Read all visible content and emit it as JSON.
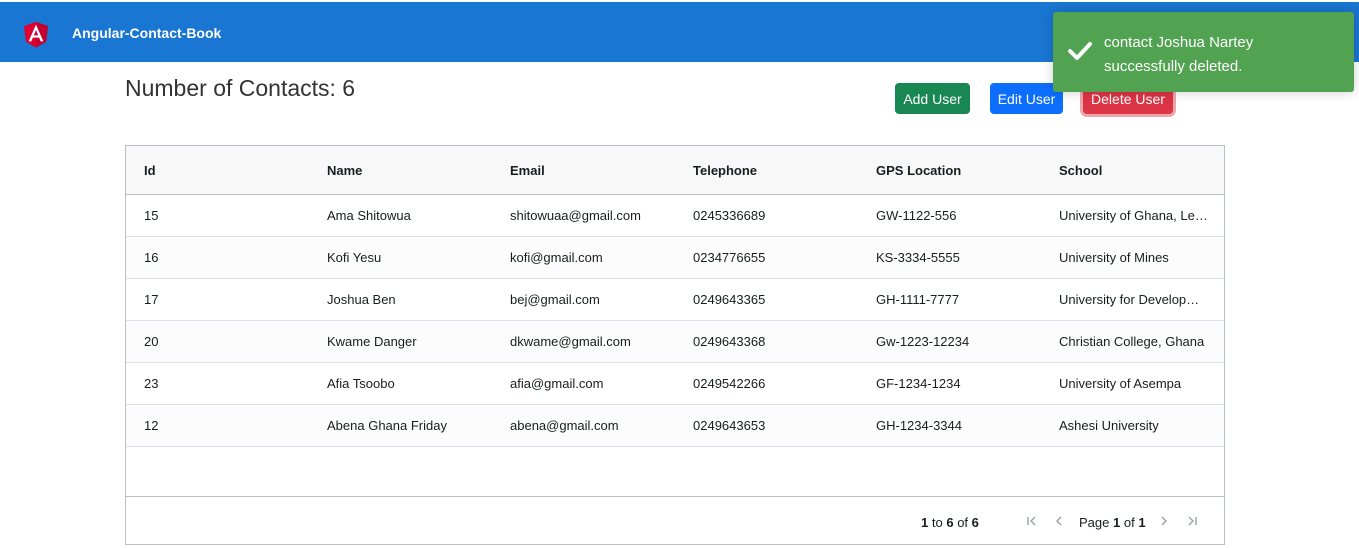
{
  "app": {
    "title": "Angular-Contact-Book"
  },
  "page": {
    "title": "Number of Contacts: 6"
  },
  "toolbar": {
    "add_label": "Add User",
    "edit_label": "Edit User",
    "delete_label": "Delete User"
  },
  "toast": {
    "message": "contact Joshua Nartey successfully deleted."
  },
  "table": {
    "columns": [
      "Id",
      "Name",
      "Email",
      "Telephone",
      "GPS Location",
      "School"
    ],
    "rows": [
      [
        "15",
        "Ama Shitowua",
        "shitowuaa@gmail.com",
        "0245336689",
        "GW-1122-556",
        "University of Ghana, Legon"
      ],
      [
        "16",
        "Kofi Yesu",
        "kofi@gmail.com",
        "0234776655",
        "KS-3334-5555",
        "University of Mines"
      ],
      [
        "17",
        "Joshua Ben",
        "bej@gmail.com",
        "0249643365",
        "GH-1111-7777",
        "University for Development Studies"
      ],
      [
        "20",
        "Kwame Danger",
        "dkwame@gmail.com",
        "0249643368",
        "Gw-1223-12234",
        "Christian College, Ghana"
      ],
      [
        "23",
        "Afia Tsoobo",
        "afia@gmail.com",
        "0249542266",
        "GF-1234-1234",
        "University of Asempa"
      ],
      [
        "12",
        "Abena Ghana Friday",
        "abena@gmail.com",
        "0249643653",
        "GH-1234-3344",
        "Ashesi University"
      ]
    ]
  },
  "pagination": {
    "from": "1",
    "to_word": "to",
    "to": "6",
    "of_word": "of",
    "total": "6",
    "page_word": "Page",
    "current": "1",
    "total_pages": "1",
    "icons": [
      "first-page-icon",
      "previous-page-icon",
      "next-page-icon",
      "last-page-icon"
    ]
  },
  "colors": {
    "header_bg": "#1976d2",
    "add": "#198754",
    "edit": "#0d6efd",
    "delete": "#dc3545",
    "toast_bg": "#51a351"
  }
}
